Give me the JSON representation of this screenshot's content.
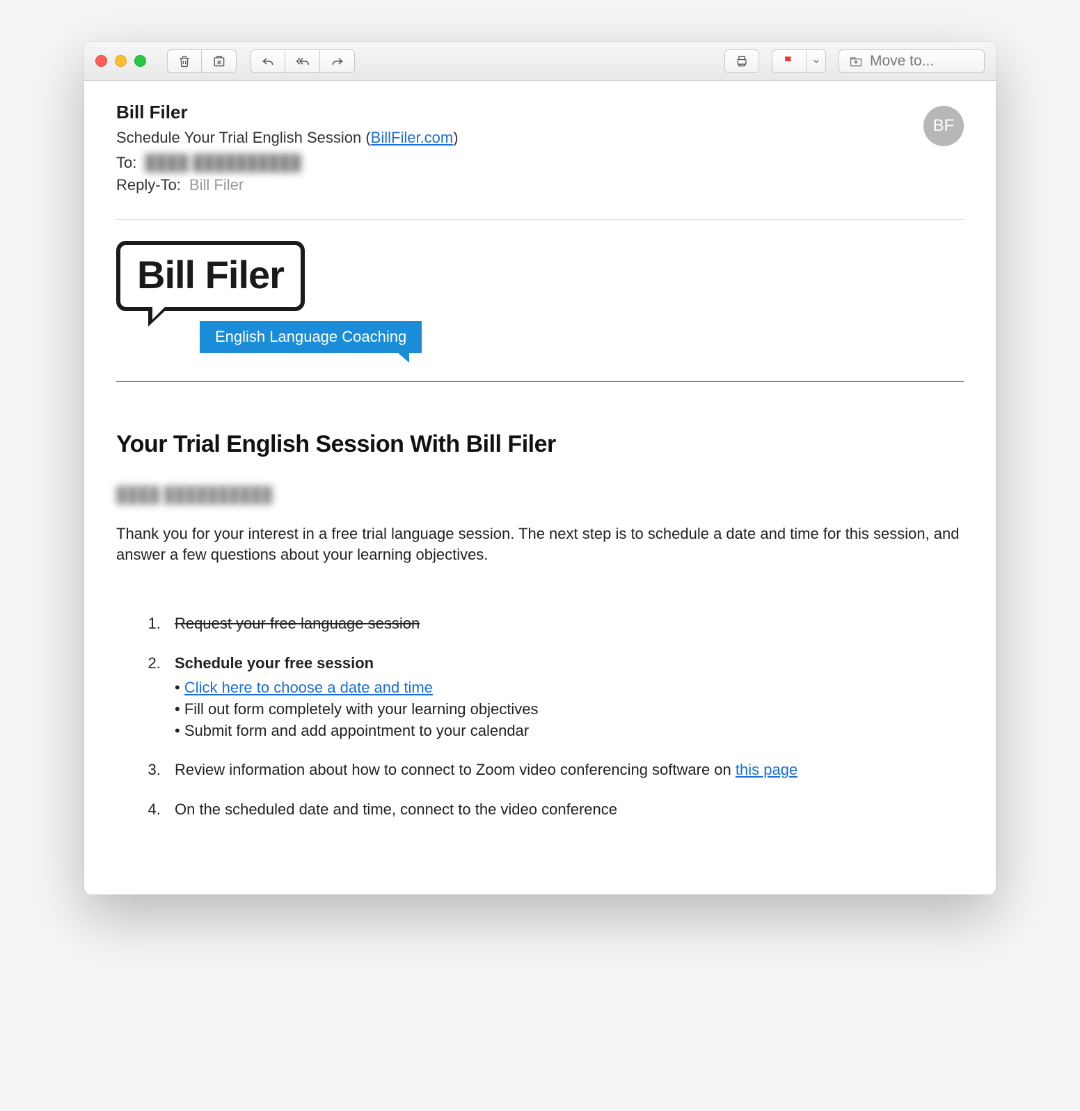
{
  "toolbar": {
    "move_label": "Move to..."
  },
  "header": {
    "sender": "Bill Filer",
    "subject_prefix": "Schedule Your Trial English Session (",
    "subject_link": "BillFiler.com",
    "subject_suffix": ")",
    "to_label": "To:",
    "to_value": "████ ██████████",
    "replyto_label": "Reply-To:",
    "replyto_value": "Bill Filer",
    "avatar_initials": "BF"
  },
  "logo": {
    "name": "Bill Filer",
    "tagline": "English Language Coaching"
  },
  "body": {
    "title": "Your Trial English Session With Bill Filer",
    "greeting": "████ ██████████",
    "paragraph": "Thank you for your interest in a free trial language session. The next step is to schedule a date and time for this session, and answer a few questions about your learning objectives.",
    "steps": {
      "s1": "Request your free language session",
      "s2_title": "Schedule your free session",
      "s2_a": "Click here to choose a date and time",
      "s2_b": "Fill out form completely with your learning objectives",
      "s2_c": "Submit form and add appointment to your calendar",
      "s3_prefix": "Review information about how to connect to Zoom video conferencing software on ",
      "s3_link": "this page",
      "s4": "On the scheduled date and time, connect to the video conference"
    }
  }
}
